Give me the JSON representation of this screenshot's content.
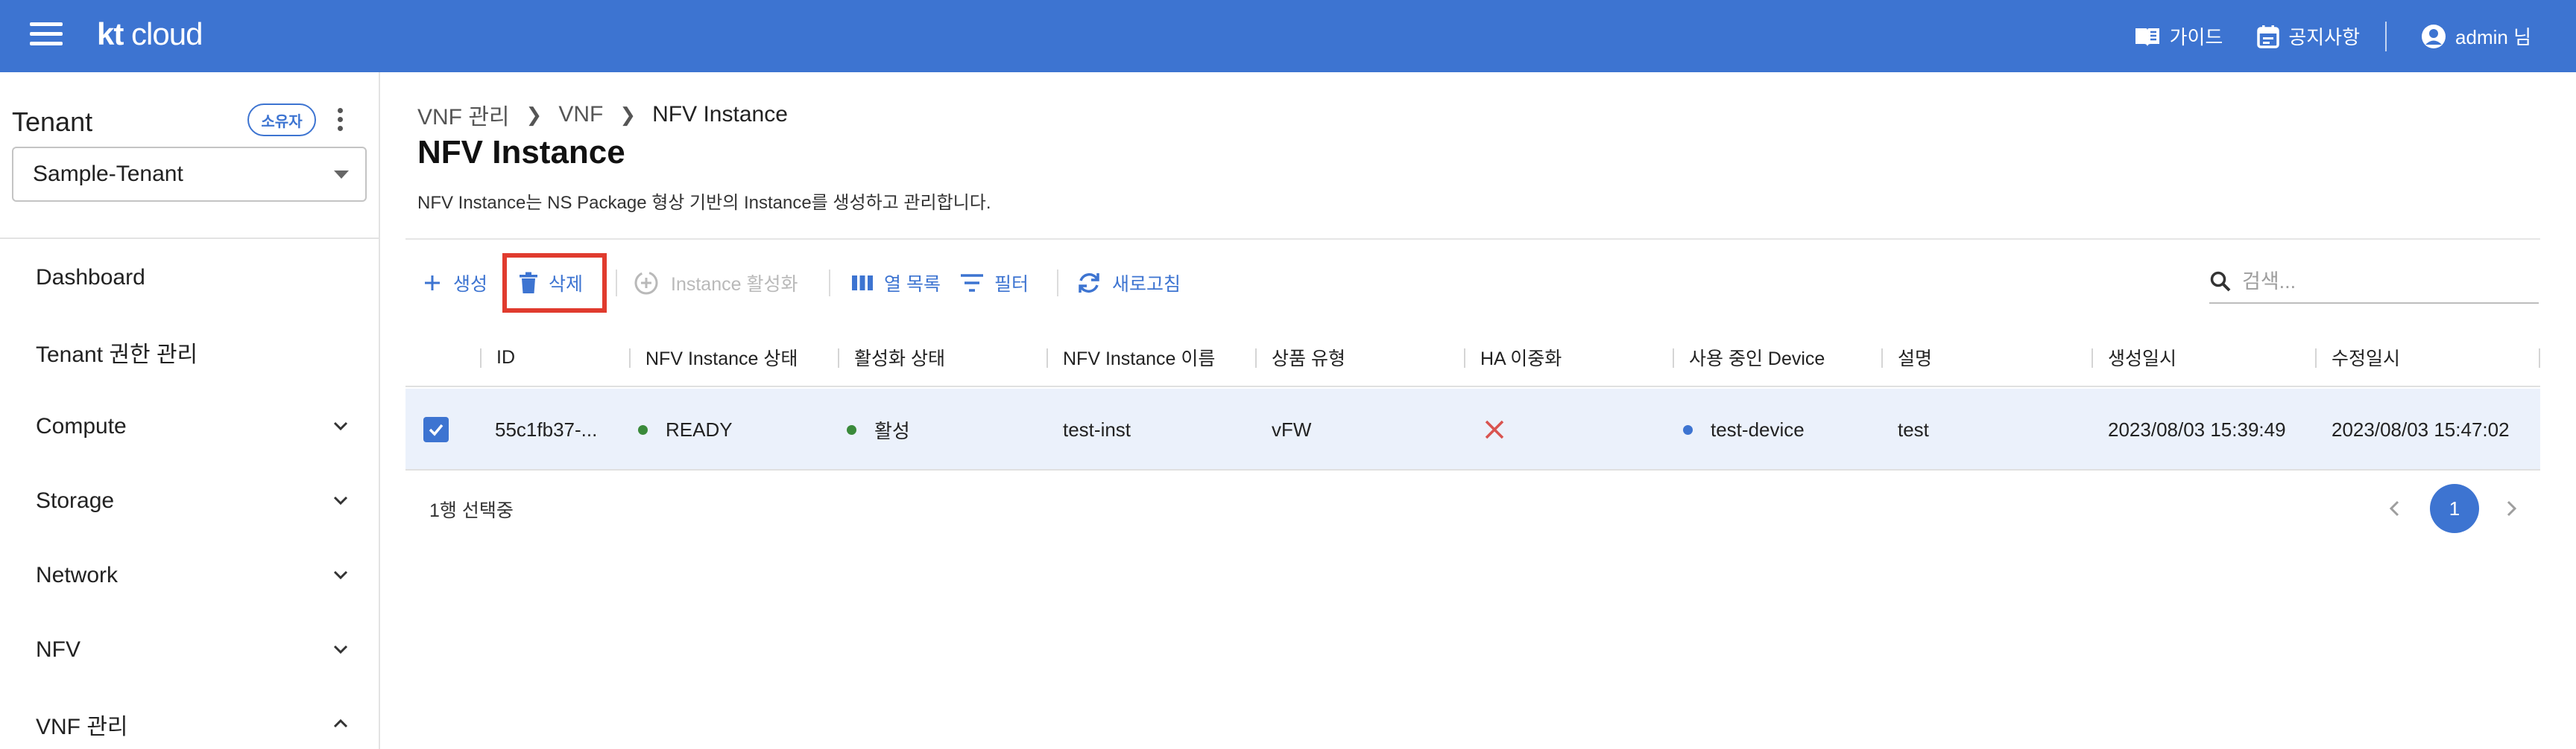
{
  "header": {
    "logo_bold": "kt",
    "logo_rest": " cloud",
    "guide_label": "가이드",
    "notice_label": "공지사항",
    "user_label": "admin 님"
  },
  "sidebar": {
    "tenant_title": "Tenant",
    "owner_badge": "소유자",
    "tenant_selected": "Sample-Tenant",
    "items": [
      {
        "label": "Dashboard",
        "expandable": false
      },
      {
        "label": "Tenant 권한 관리",
        "expandable": false
      },
      {
        "label": "Compute",
        "expandable": true,
        "expanded": false
      },
      {
        "label": "Storage",
        "expandable": true,
        "expanded": false
      },
      {
        "label": "Network",
        "expandable": true,
        "expanded": false
      },
      {
        "label": "NFV",
        "expandable": true,
        "expanded": false
      },
      {
        "label": "VNF 관리",
        "expandable": true,
        "expanded": true
      }
    ]
  },
  "breadcrumb": [
    "VNF 관리",
    "VNF",
    "NFV Instance"
  ],
  "page": {
    "title": "NFV Instance",
    "description": "NFV Instance는 NS Package 형상 기반의 Instance를 생성하고 관리합니다."
  },
  "toolbar": {
    "create_label": "생성",
    "delete_label": "삭제",
    "activate_label": "Instance 활성화",
    "columns_label": "열 목록",
    "filter_label": "필터",
    "refresh_label": "새로고침",
    "search_placeholder": "검색..."
  },
  "table": {
    "columns": [
      "ID",
      "NFV Instance 상태",
      "활성화 상태",
      "NFV Instance 이름",
      "상품 유형",
      "HA 이중화",
      "사용 중인 Device",
      "설명",
      "생성일시",
      "수정일시"
    ],
    "rows": [
      {
        "selected": true,
        "id": "55c1fb37-...",
        "state": "READY",
        "active": "활성",
        "name": "test-inst",
        "product_type": "vFW",
        "ha": false,
        "device": "test-device",
        "description": "test",
        "created": "2023/08/03 15:39:49",
        "modified": "2023/08/03 15:47:02"
      }
    ],
    "selection_status": "1행 선택중"
  },
  "pagination": {
    "current": "1"
  },
  "colors": {
    "primary": "#3d74d1",
    "highlight": "#e03b2e",
    "status_ok": "#3a8a3a",
    "ha_false": "#d9534f",
    "device_dot": "#3d74d1"
  }
}
